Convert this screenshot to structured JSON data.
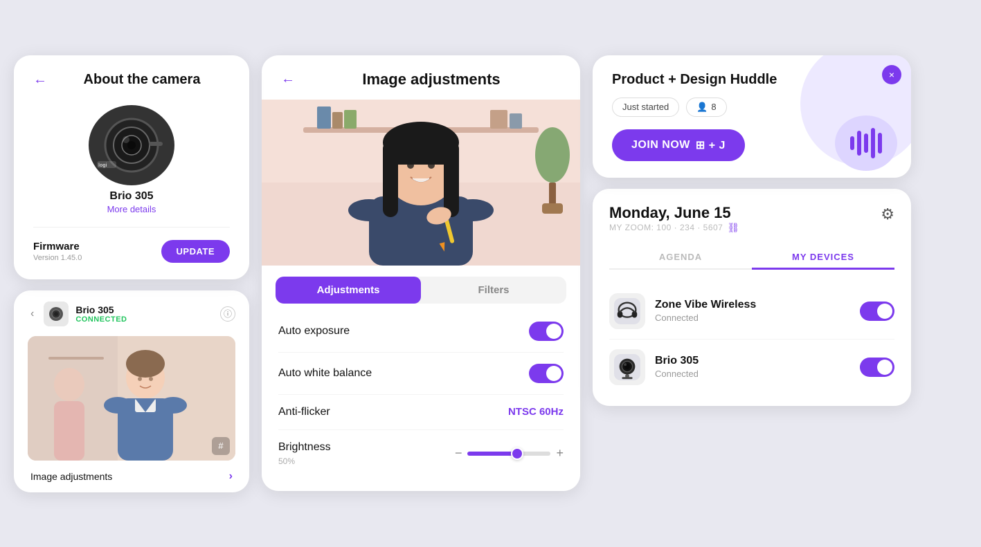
{
  "left_top": {
    "back_label": "←",
    "title": "About the camera",
    "device_name": "Brio 305",
    "more_details_label": "More details",
    "firmware_label": "Firmware",
    "firmware_version": "Version 1.45.0",
    "update_btn_label": "UPDATE"
  },
  "left_bottom": {
    "prev_btn_label": "‹",
    "device_name": "Brio 305",
    "status_label": "CONNECTED",
    "info_icon": "ⓘ",
    "hash_icon": "#",
    "image_adjustments_label": "Image adjustments"
  },
  "middle": {
    "back_label": "←",
    "title": "Image adjustments",
    "tab_adjustments": "Adjustments",
    "tab_filters": "Filters",
    "auto_exposure_label": "Auto exposure",
    "auto_white_balance_label": "Auto white balance",
    "anti_flicker_label": "Anti-flicker",
    "anti_flicker_value": "NTSC 60Hz",
    "brightness_label": "Brightness",
    "brightness_pct": "50%",
    "minus_icon": "−",
    "plus_icon": "+",
    "auto_exposure_on": true,
    "auto_white_balance_on": true
  },
  "right_top": {
    "close_icon": "×",
    "title": "Product + Design Huddle",
    "status_badge": "Just started",
    "people_count": "8",
    "people_icon": "👤",
    "join_btn_label": "JOIN NOW",
    "join_shortcut": "⊞ + J",
    "wave_icon": "audio-wave-icon"
  },
  "right_bottom": {
    "date": "Monday, June 15",
    "zoom_label": "MY ZOOM: 100 · 234 · 5607",
    "link_icon": "⛓",
    "gear_icon": "⚙",
    "tab_agenda": "AGENDA",
    "tab_my_devices": "MY DEVICES",
    "devices": [
      {
        "name": "Zone Vibe Wireless",
        "status": "Connected",
        "toggle_on": true
      },
      {
        "name": "Brio 305",
        "status": "Connected",
        "toggle_on": true
      }
    ]
  },
  "icons": {
    "headphones": "headphones",
    "webcam": "webcam",
    "shield": "shield",
    "gear": "gear"
  }
}
